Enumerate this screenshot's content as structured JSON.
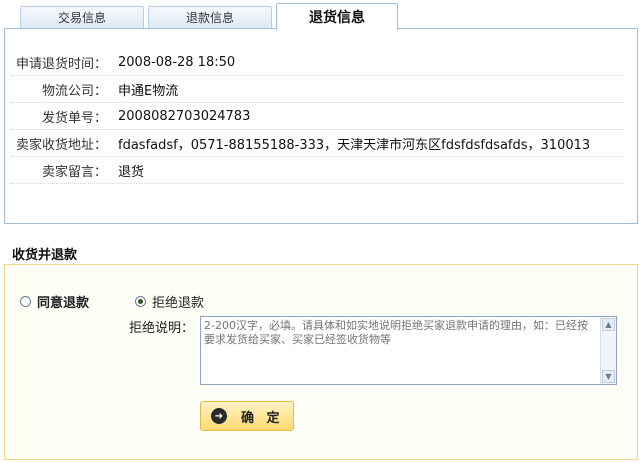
{
  "tabs": [
    {
      "label": "交易信息",
      "active": false
    },
    {
      "label": "退款信息",
      "active": false
    },
    {
      "label": "退货信息",
      "active": true
    }
  ],
  "info": [
    {
      "label": "申请退货时间：",
      "value": "2008-08-28 18:50"
    },
    {
      "label": "物流公司：",
      "value": "申通E物流"
    },
    {
      "label": "发货单号：",
      "value": "2008082703024783"
    },
    {
      "label": "卖家收货地址：",
      "value": "fdasfadsf，0571-88155188-333，天津天津市河东区fdsfdsfdsafds，310013"
    },
    {
      "label": "卖家留言：",
      "value": "退货"
    }
  ],
  "section": {
    "title": "收货并退款"
  },
  "refund": {
    "agree_label": "同意退款",
    "reject_label": "拒绝退款",
    "selected": "reject",
    "reason_label": "拒绝说明：",
    "reason_placeholder": "2-200汉字，必填。请具体和如实地说明拒绝买家退款申请的理由，如：已经按要求发货给买家、买家已经签收货物等",
    "reason_value": "",
    "confirm_label": "确 定"
  },
  "icons": {
    "confirm": "arrow-right-circle-icon",
    "scroll_up": "scroll-up-icon",
    "scroll_down": "scroll-down-icon"
  }
}
